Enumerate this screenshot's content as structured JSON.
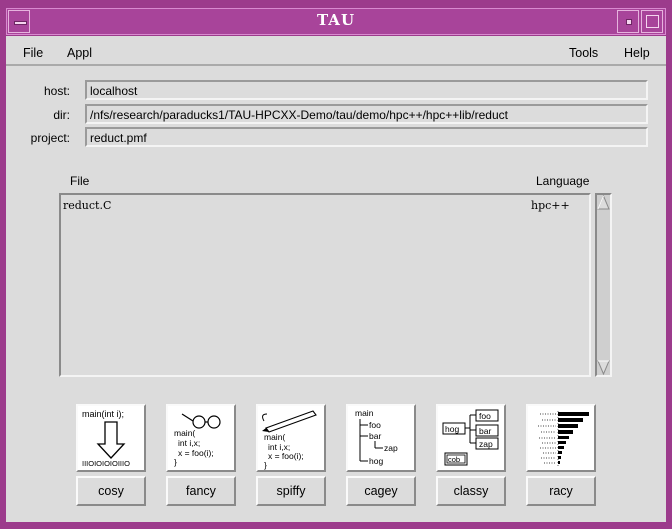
{
  "window": {
    "title": "TAU"
  },
  "menubar": {
    "left": [
      "File",
      "Appl"
    ],
    "right": [
      "Tools",
      "Help"
    ]
  },
  "fields": {
    "host": {
      "label": "host:",
      "value": "localhost"
    },
    "dir": {
      "label": "dir:",
      "value": "/nfs/research/paraducks1/TAU-HPCXX-Demo/tau/demo/hpc++/hpc++lib/reduct"
    },
    "project": {
      "label": "project:",
      "value": "reduct.pmf"
    }
  },
  "file_list": {
    "headers": {
      "file": "File",
      "language": "Language"
    },
    "rows": [
      {
        "file": "reduct.C",
        "language": "hpc++"
      }
    ]
  },
  "tools": [
    {
      "name": "cosy",
      "icon": "cosy-icon",
      "icon_text": [
        "main(int i);",
        "IIIOIOIOIOIIIO"
      ]
    },
    {
      "name": "fancy",
      "icon": "fancy-icon",
      "icon_text": [
        "main(",
        "int i,x;",
        "x = foo(i);",
        "}"
      ]
    },
    {
      "name": "spiffy",
      "icon": "spiffy-icon",
      "icon_text": [
        "main(",
        "int i,x;",
        "x = foo(i);",
        "}"
      ]
    },
    {
      "name": "cagey",
      "icon": "cagey-icon",
      "icon_text": [
        "main",
        "foo",
        "bar",
        "zap",
        "hog"
      ]
    },
    {
      "name": "classy",
      "icon": "classy-icon",
      "icon_text": [
        "hog",
        "foo",
        "bar",
        "zap",
        "cob"
      ]
    },
    {
      "name": "racy",
      "icon": "racy-icon",
      "icon_text": []
    }
  ]
}
